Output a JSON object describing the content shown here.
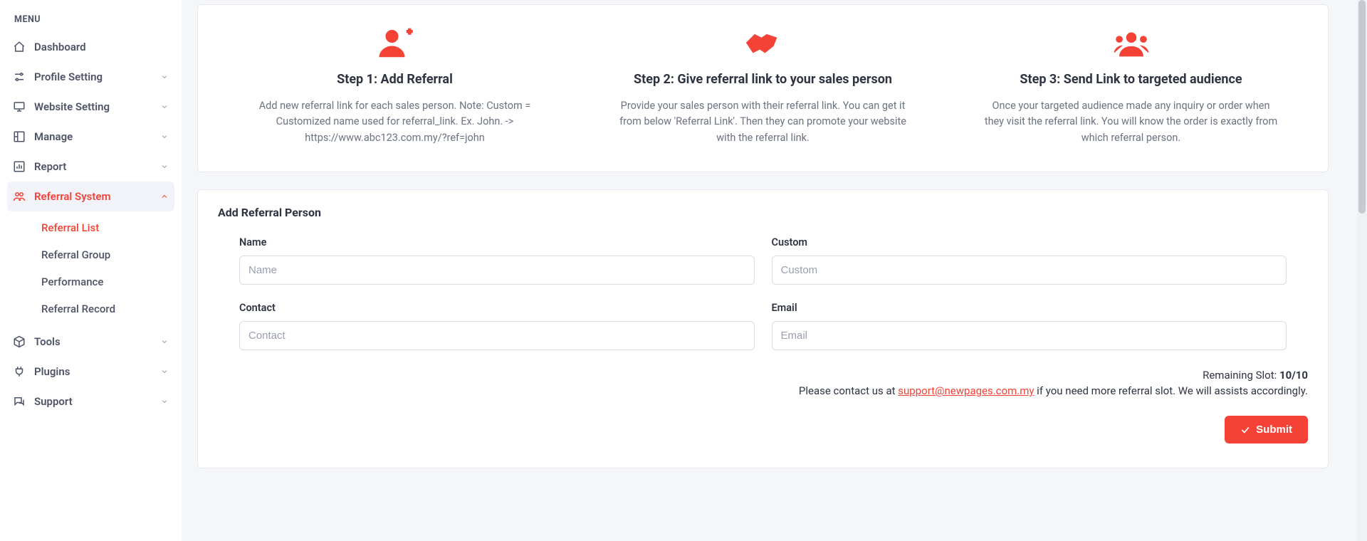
{
  "sidebar": {
    "menu_heading": "MENU",
    "items": [
      {
        "label": "Dashboard"
      },
      {
        "label": "Profile Setting"
      },
      {
        "label": "Website Setting"
      },
      {
        "label": "Manage"
      },
      {
        "label": "Report"
      },
      {
        "label": "Referral System"
      },
      {
        "label": "Tools"
      },
      {
        "label": "Plugins"
      },
      {
        "label": "Support"
      }
    ],
    "referral_sub": [
      "Referral List",
      "Referral Group",
      "Performance",
      "Referral Record"
    ]
  },
  "steps": [
    {
      "title": "Step 1: Add Referral",
      "desc": "Add new referral link for each sales person. Note: Custom = Customized name used for referral_link. Ex. John. -> https://www.abc123.com.my/?ref=john"
    },
    {
      "title": "Step 2: Give referral link to your sales person",
      "desc": "Provide your sales person with their referral link. You can get it from below 'Referral Link'. Then they can promote your website with the referral link."
    },
    {
      "title": "Step 3: Send Link to targeted audience",
      "desc": "Once your targeted audience made any inquiry or order when they visit the referral link. You will know the order is exactly from which referral person."
    }
  ],
  "form": {
    "title": "Add Referral Person",
    "name": {
      "label": "Name",
      "placeholder": "Name",
      "value": ""
    },
    "custom": {
      "label": "Custom",
      "placeholder": "Custom",
      "value": ""
    },
    "contact": {
      "label": "Contact",
      "placeholder": "Contact",
      "value": ""
    },
    "email": {
      "label": "Email",
      "placeholder": "Email",
      "value": ""
    },
    "remaining_label": "Remaining Slot: ",
    "remaining_value": "10/10",
    "contact_pre": "Please contact us at ",
    "contact_mail": "support@newpages.com.my",
    "contact_post": " if you need more referral slot. We will assists accordingly.",
    "submit_label": "Submit"
  }
}
